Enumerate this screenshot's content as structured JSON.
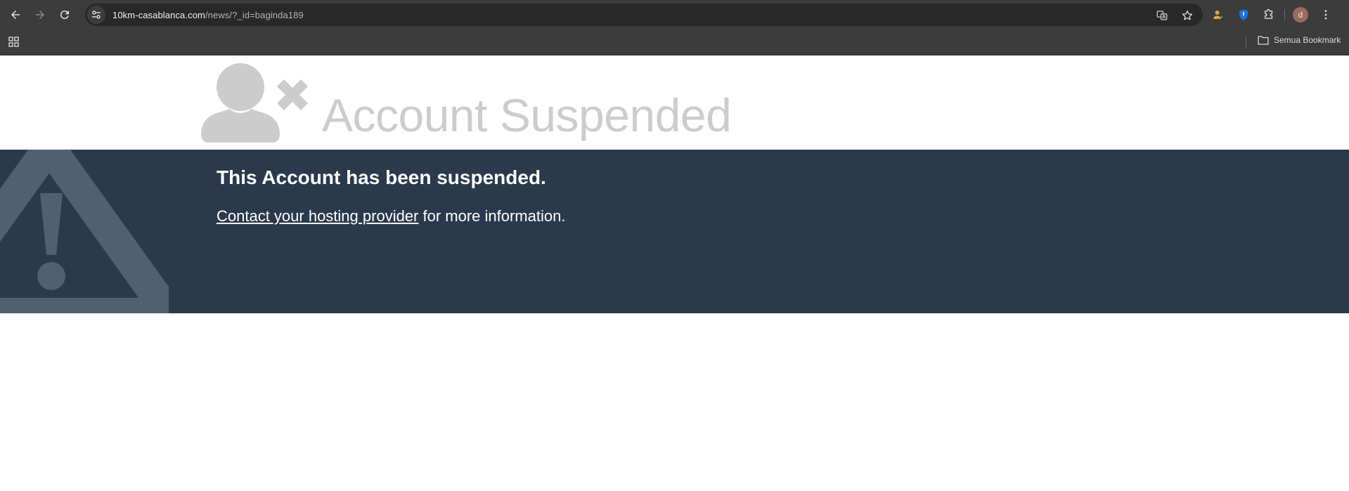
{
  "browser": {
    "url_host": "10km-casablanca.com",
    "url_path": "/news/?_id=baginda189",
    "bookmarks_folder_label": "Semua Bookmark",
    "profile_initial": "d",
    "colors": {
      "toolbar": "#3c3c3c",
      "omnibox": "#282828"
    }
  },
  "page": {
    "title": "Account Suspended",
    "heading": "This Account has been suspended.",
    "contact_link_text": "Contact your hosting provider",
    "contact_suffix": " for more information.",
    "colors": {
      "banner": "#2a3a4c",
      "title": "#cccccc",
      "icon": "#cccccc",
      "warning_icon": "#4f6072"
    }
  }
}
